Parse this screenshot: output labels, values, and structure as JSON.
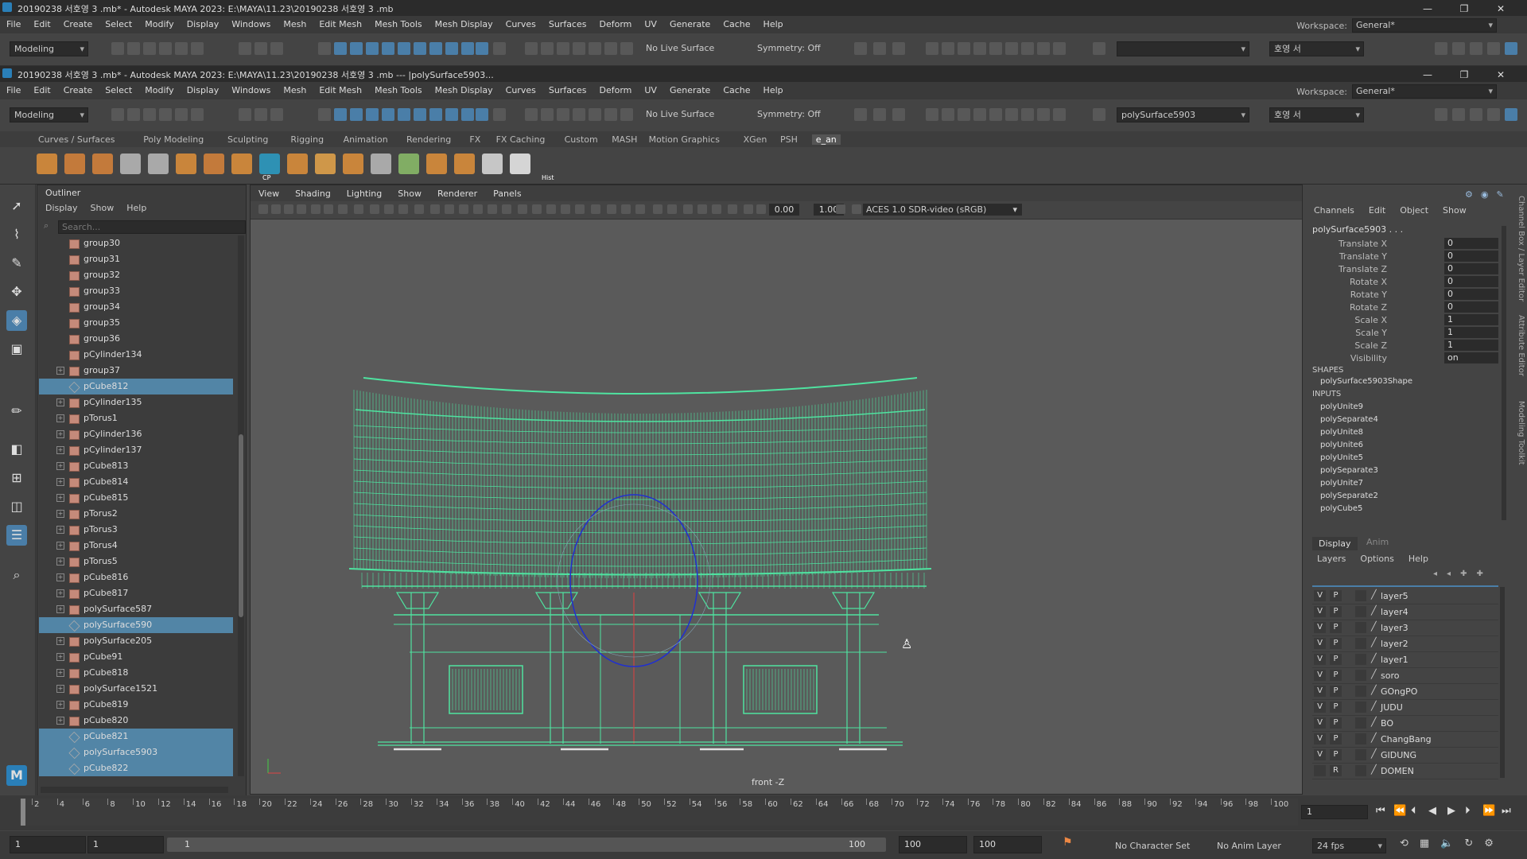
{
  "outer_window": {
    "title": "20190238 서호영 3 .mb* - Autodesk MAYA 2023: E:\\MAYA\\11.23\\20190238 서호영 3 .mb",
    "controls": [
      "—",
      "❐",
      "✕"
    ]
  },
  "inner_window": {
    "title": "20190238 서호영 3 .mb* - Autodesk MAYA 2023: E:\\MAYA\\11.23\\20190238 서호영 3 .mb   ---   |polySurface5903...",
    "controls": [
      "—",
      "❐",
      "✕"
    ]
  },
  "menu": [
    "File",
    "Edit",
    "Create",
    "Select",
    "Modify",
    "Display",
    "Windows",
    "Mesh",
    "Edit Mesh",
    "Mesh Tools",
    "Mesh Display",
    "Curves",
    "Surfaces",
    "Deform",
    "UV",
    "Generate",
    "Cache",
    "Help"
  ],
  "workspace": {
    "label": "Workspace:",
    "value": "General*"
  },
  "status_line": {
    "mode": "Modeling",
    "live_surface": "No Live Surface",
    "symmetry": "Symmetry: Off",
    "outer_name_field": "",
    "inner_name_field": "polySurface5903",
    "user": "호영 서"
  },
  "shelf": {
    "tabs": [
      "Curves / Surfaces",
      "Poly Modeling",
      "Sculpting",
      "Rigging",
      "Animation",
      "Rendering",
      "FX",
      "FX Caching",
      "Custom",
      "MASH",
      "Motion Graphics",
      "XGen",
      "PSH",
      "e_an"
    ],
    "active_tab": "e_an",
    "icon_labels": {
      "cp": "CP",
      "hist": "Hist"
    }
  },
  "outliner": {
    "title": "Outliner",
    "menu": [
      "Display",
      "Show",
      "Help"
    ],
    "search_placeholder": "Search...",
    "items": [
      {
        "name": "group30",
        "type": "group",
        "expand": false,
        "selected": false
      },
      {
        "name": "group31",
        "type": "group",
        "expand": false,
        "selected": false
      },
      {
        "name": "group32",
        "type": "group",
        "expand": false,
        "selected": false
      },
      {
        "name": "group33",
        "type": "group",
        "expand": false,
        "selected": false
      },
      {
        "name": "group34",
        "type": "group",
        "expand": false,
        "selected": false
      },
      {
        "name": "group35",
        "type": "group",
        "expand": false,
        "selected": false
      },
      {
        "name": "group36",
        "type": "group",
        "expand": false,
        "selected": false
      },
      {
        "name": "pCylinder134",
        "type": "group",
        "expand": false,
        "selected": false
      },
      {
        "name": "group37",
        "type": "group",
        "expand": true,
        "selected": false
      },
      {
        "name": "pCube812",
        "type": "mesh",
        "expand": false,
        "selected": true
      },
      {
        "name": "pCylinder135",
        "type": "group",
        "expand": true,
        "selected": false
      },
      {
        "name": "pTorus1",
        "type": "group",
        "expand": true,
        "selected": false
      },
      {
        "name": "pCylinder136",
        "type": "group",
        "expand": true,
        "selected": false
      },
      {
        "name": "pCylinder137",
        "type": "group",
        "expand": true,
        "selected": false
      },
      {
        "name": "pCube813",
        "type": "group",
        "expand": true,
        "selected": false
      },
      {
        "name": "pCube814",
        "type": "group",
        "expand": true,
        "selected": false
      },
      {
        "name": "pCube815",
        "type": "group",
        "expand": true,
        "selected": false
      },
      {
        "name": "pTorus2",
        "type": "group",
        "expand": true,
        "selected": false
      },
      {
        "name": "pTorus3",
        "type": "group",
        "expand": true,
        "selected": false
      },
      {
        "name": "pTorus4",
        "type": "group",
        "expand": true,
        "selected": false
      },
      {
        "name": "pTorus5",
        "type": "group",
        "expand": true,
        "selected": false
      },
      {
        "name": "pCube816",
        "type": "group",
        "expand": true,
        "selected": false
      },
      {
        "name": "pCube817",
        "type": "group",
        "expand": true,
        "selected": false
      },
      {
        "name": "polySurface587",
        "type": "group",
        "expand": true,
        "selected": false
      },
      {
        "name": "polySurface590",
        "type": "mesh",
        "expand": false,
        "selected": true
      },
      {
        "name": "polySurface205",
        "type": "group",
        "expand": true,
        "selected": false
      },
      {
        "name": "pCube91",
        "type": "group",
        "expand": true,
        "selected": false
      },
      {
        "name": "pCube818",
        "type": "group",
        "expand": true,
        "selected": false
      },
      {
        "name": "polySurface1521",
        "type": "group",
        "expand": true,
        "selected": false
      },
      {
        "name": "pCube819",
        "type": "group",
        "expand": true,
        "selected": false
      },
      {
        "name": "pCube820",
        "type": "group",
        "expand": true,
        "selected": false
      },
      {
        "name": "pCube821",
        "type": "mesh",
        "expand": false,
        "selected": true
      },
      {
        "name": "polySurface5903",
        "type": "mesh",
        "expand": false,
        "selected": true
      },
      {
        "name": "pCube822",
        "type": "mesh",
        "expand": false,
        "selected": true
      }
    ]
  },
  "viewport": {
    "menu": [
      "View",
      "Shading",
      "Lighting",
      "Show",
      "Renderer",
      "Panels"
    ],
    "near_value": "0.00",
    "far_value": "1.00",
    "color_space": "ACES 1.0 SDR-video (sRGB)",
    "camera": "front -Z",
    "wire_color": "#4fe3a0"
  },
  "channel_box": {
    "menu": [
      "Channels",
      "Edit",
      "Object",
      "Show"
    ],
    "object": "polySurface5903 . . .",
    "attributes": [
      {
        "k": "Translate X",
        "v": "0"
      },
      {
        "k": "Translate Y",
        "v": "0"
      },
      {
        "k": "Translate Z",
        "v": "0"
      },
      {
        "k": "Rotate X",
        "v": "0"
      },
      {
        "k": "Rotate Y",
        "v": "0"
      },
      {
        "k": "Rotate Z",
        "v": "0"
      },
      {
        "k": "Scale X",
        "v": "1"
      },
      {
        "k": "Scale Y",
        "v": "1"
      },
      {
        "k": "Scale Z",
        "v": "1"
      },
      {
        "k": "Visibility",
        "v": "on"
      }
    ],
    "shapes_label": "SHAPES",
    "shapes": [
      "polySurface5903Shape"
    ],
    "inputs_label": "INPUTS",
    "inputs": [
      "polyUnite9",
      "polySeparate4",
      "polyUnite8",
      "polyUnite6",
      "polyUnite5",
      "polySeparate3",
      "polyUnite7",
      "polySeparate2",
      "polyCube5"
    ]
  },
  "side_tabs": [
    "Channel Box / Layer Editor",
    "Attribute Editor",
    "Modeling Toolkit"
  ],
  "layer_editor": {
    "tabs": [
      "Display",
      "Anim"
    ],
    "menu": [
      "Layers",
      "Options",
      "Help"
    ],
    "layers": [
      {
        "v": "V",
        "p": "P",
        "name": "layer5"
      },
      {
        "v": "V",
        "p": "P",
        "name": "layer4"
      },
      {
        "v": "V",
        "p": "P",
        "name": "layer3"
      },
      {
        "v": "V",
        "p": "P",
        "name": "layer2"
      },
      {
        "v": "V",
        "p": "P",
        "name": "layer1"
      },
      {
        "v": "V",
        "p": "P",
        "name": "soro"
      },
      {
        "v": "V",
        "p": "P",
        "name": "GOngPO"
      },
      {
        "v": "V",
        "p": "P",
        "name": "JUDU"
      },
      {
        "v": "V",
        "p": "P",
        "name": "BO"
      },
      {
        "v": "V",
        "p": "P",
        "name": "ChangBang"
      },
      {
        "v": "V",
        "p": "P",
        "name": "GIDUNG"
      },
      {
        "v": "",
        "p": "R",
        "name": "DOMEN"
      }
    ]
  },
  "timeline": {
    "ticks": [
      "2",
      "4",
      "6",
      "8",
      "10",
      "12",
      "14",
      "16",
      "18",
      "20",
      "22",
      "24",
      "26",
      "28",
      "30",
      "32",
      "34",
      "36",
      "38",
      "40",
      "42",
      "44",
      "46",
      "48",
      "50",
      "52",
      "54",
      "56",
      "58",
      "60",
      "62",
      "64",
      "66",
      "68",
      "70",
      "72",
      "74",
      "76",
      "78",
      "80",
      "82",
      "84",
      "86",
      "88",
      "90",
      "92",
      "94",
      "96",
      "98",
      "100"
    ],
    "current_frame": "1"
  },
  "range": {
    "start": "1",
    "start_playback": "1",
    "slider_start": "1",
    "slider_end": "100",
    "end_playback": "100",
    "end": "100",
    "character_set": "No Character Set",
    "anim_layer": "No Anim Layer",
    "fps": "24 fps"
  }
}
